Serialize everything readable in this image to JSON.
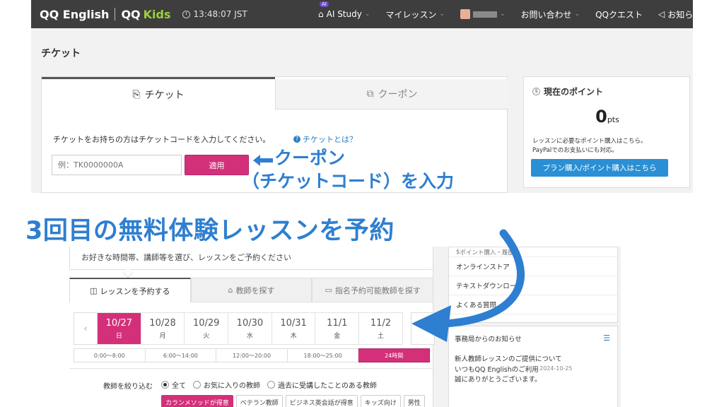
{
  "topbar": {
    "logo_main": "QQ English",
    "logo_kids_prefix": "QQ",
    "logo_kids": "Kids",
    "clock": "13:48:07 JST",
    "ai_badge": "AI",
    "nav": {
      "ai_study": "AI Study",
      "my_lessons": "マイレッスン",
      "contact": "お問い合わせ",
      "quest": "QQクエスト",
      "news": "お知らせ"
    }
  },
  "ticket_page": {
    "title": "チケット",
    "tab_ticket": "チケット",
    "tab_coupon": "クーポン",
    "description": "チケットをお持ちの方はチケットコードを入力してください。",
    "help_link": "チケットとは？",
    "input_placeholder": "例：TK0000000A",
    "apply_button": "適用"
  },
  "points": {
    "heading": "現在のポイント",
    "value": "0",
    "unit": "pts",
    "note_line1": "レッスンに必要なポイント購入はこちら。",
    "note_line2": "PayPalでのお支払いにも対応。",
    "button": "プラン購入/ポイント購入はこちら"
  },
  "annotations": {
    "coupon_line1": "クーポン",
    "coupon_line2": "（チケットコード）を入力",
    "headline": "3回目の無料体験レッスンを予約",
    "color": "#2e7fd0"
  },
  "booking": {
    "intro": "お好きな時間帯、講師等を選び、レッスンをご予約ください",
    "tabs": [
      "レッスンを予約する",
      "教師を探す",
      "指名予約可能教師を探す"
    ],
    "dates": [
      {
        "d": "10/27",
        "w": "日"
      },
      {
        "d": "10/28",
        "w": "月"
      },
      {
        "d": "10/29",
        "w": "火"
      },
      {
        "d": "10/30",
        "w": "水"
      },
      {
        "d": "10/31",
        "w": "木"
      },
      {
        "d": "11/1",
        "w": "金"
      },
      {
        "d": "11/2",
        "w": "土"
      }
    ],
    "time_slots": [
      "0:00〜8:00",
      "6:00〜14:00",
      "12:00〜20:00",
      "18:00〜25:00",
      "24時間"
    ],
    "filter_label": "教師を絞り込む",
    "radios": [
      "全て",
      "お気に入りの教師",
      "過去に受講したことのある教師"
    ],
    "chips": [
      "カランメソッドが得意",
      "ベテラン教師",
      "ビジネス英会話が得意",
      "キッズ向け",
      "男性"
    ]
  },
  "sidebar": {
    "items": [
      "ポイント購入・履歴",
      "オンラインストア",
      "テキストダウンロード",
      "よくある質問"
    ],
    "news_heading": "事務局からのお知らせ",
    "news_title": "新人教師レッスンのご提供について",
    "news_body": "いつもQQ Englishのご利用誠にありがとうございます。",
    "news_date": "2024-10-25"
  },
  "colors": {
    "brand_pink": "#d4307a",
    "link_blue": "#2a7fc9",
    "topbar": "#3e3e3e"
  }
}
